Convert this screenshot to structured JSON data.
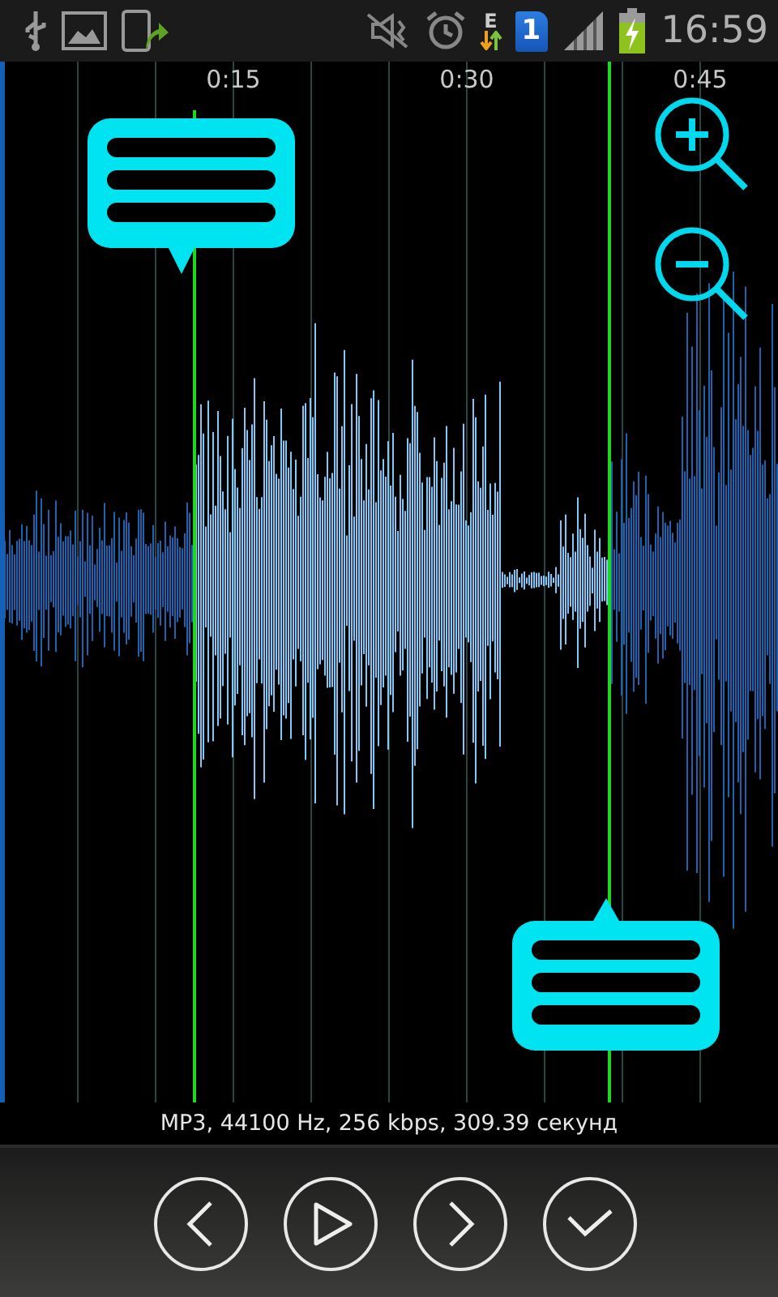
{
  "status_bar": {
    "network_type": "E",
    "sim_slot": "1",
    "time": "16:59"
  },
  "timeline": {
    "labels": [
      "0:15",
      "0:30",
      "0:45"
    ]
  },
  "file_info": "MP3, 44100 Hz, 256 kbps, 309.39 секунд"
}
